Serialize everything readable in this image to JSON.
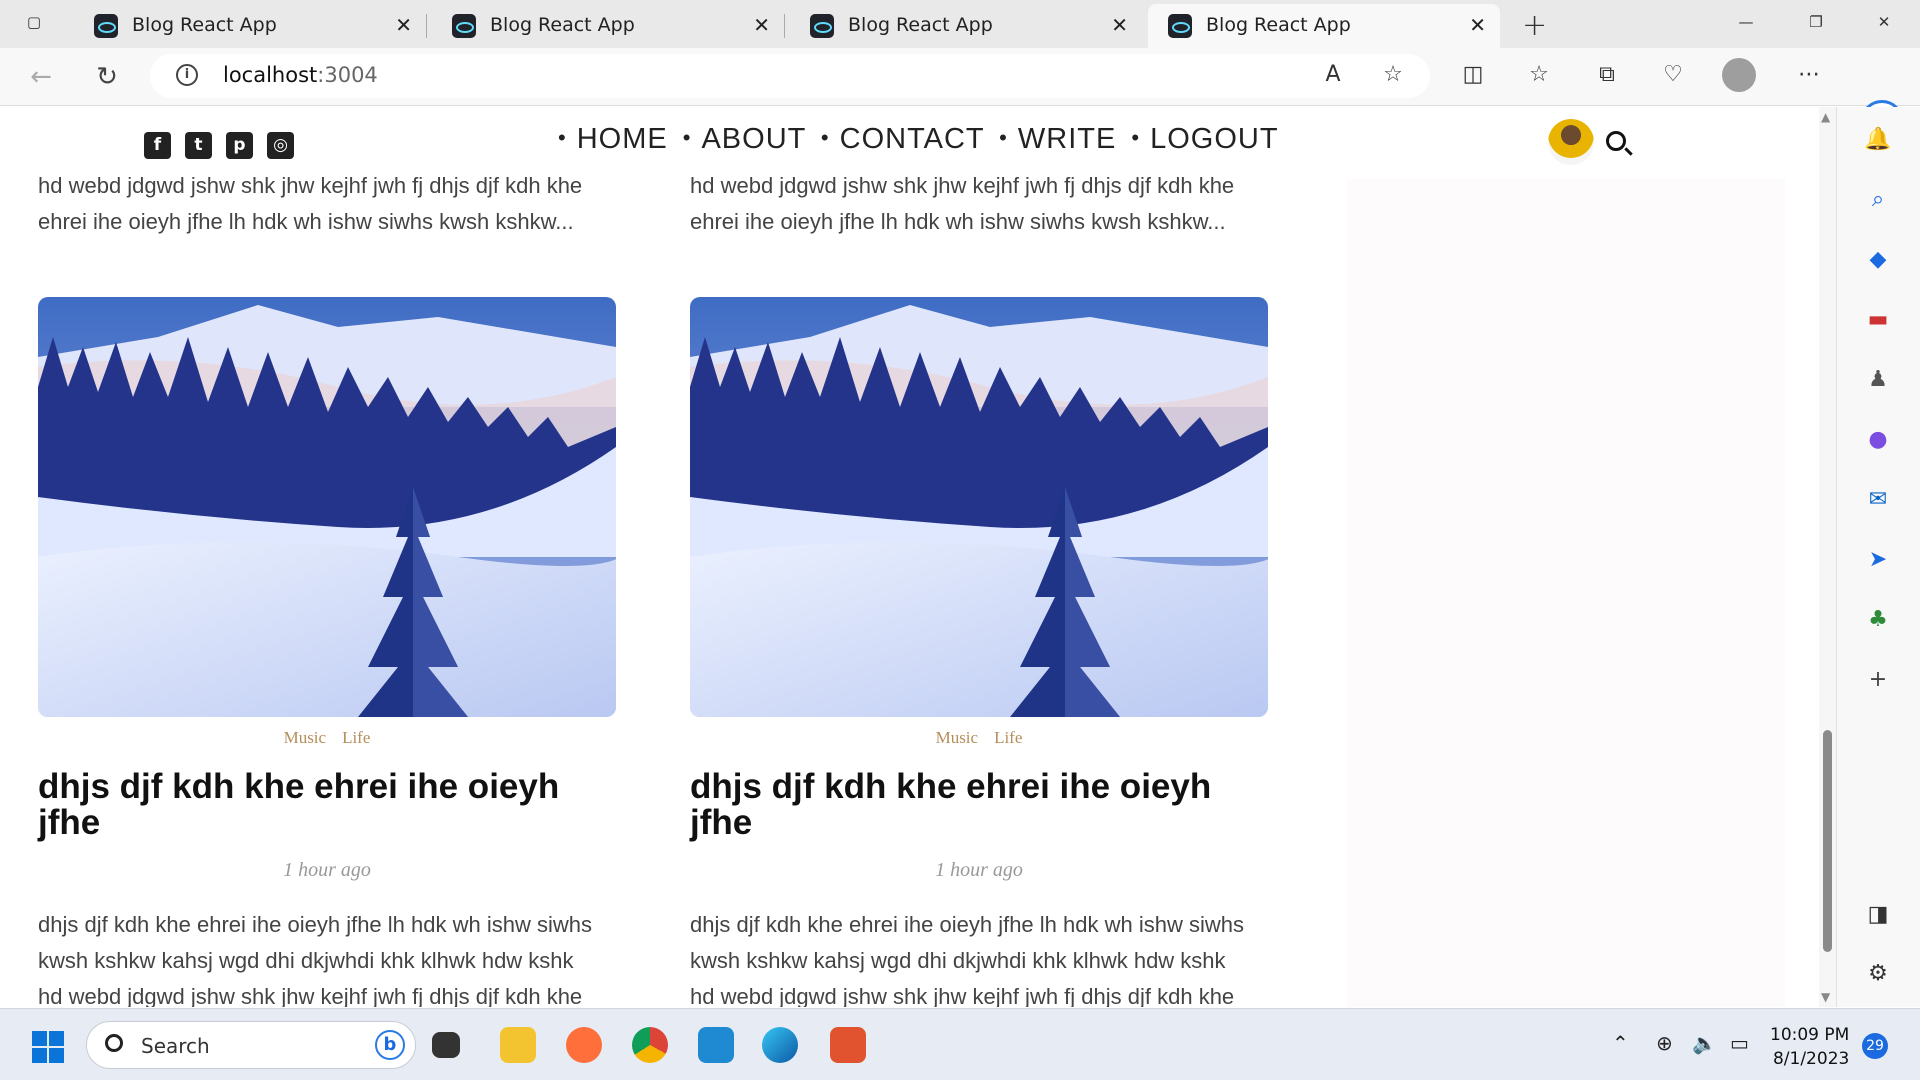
{
  "browser": {
    "tabs": [
      {
        "title": "Blog React App"
      },
      {
        "title": "Blog React App"
      },
      {
        "title": "Blog React App"
      },
      {
        "title": "Blog React App"
      }
    ],
    "url_host": "localhost",
    "url_port": ":3004"
  },
  "nav": {
    "items": [
      "HOME",
      "ABOUT",
      "CONTACT",
      "WRITE",
      "LOGOUT"
    ]
  },
  "posts": [
    {
      "top_excerpt_line1": "hd webd jdgwd jshw shk jhw kejhf jwh fj dhjs djf kdh khe",
      "top_excerpt_line2": "ehrei ihe oieyh jfhe lh hdk wh ishw siwhs kwsh kshkw...",
      "cat1": "Music",
      "cat2": "Life",
      "title": "dhjs djf kdh khe ehrei ihe oieyh jfhe",
      "time": "1 hour ago",
      "desc_line1": "dhjs djf kdh khe ehrei ihe oieyh jfhe lh hdk wh ishw siwhs",
      "desc_line2": "kwsh kshkw kahsj wgd dhi dkjwhdi khk klhwk hdw kshk",
      "desc_line3": "hd webd jdgwd jshw shk jhw kejhf jwh fj dhjs djf kdh khe"
    },
    {
      "top_excerpt_line1": "hd webd jdgwd jshw shk jhw kejhf jwh fj dhjs djf kdh khe",
      "top_excerpt_line2": "ehrei ihe oieyh jfhe lh hdk wh ishw siwhs kwsh kshkw...",
      "cat1": "Music",
      "cat2": "Life",
      "title": "dhjs djf kdh khe ehrei ihe oieyh jfhe",
      "time": "1 hour ago",
      "desc_line1": "dhjs djf kdh khe ehrei ihe oieyh jfhe lh hdk wh ishw siwhs",
      "desc_line2": "kwsh kshkw kahsj wgd dhi dkjwhdi khk klhwk hdw kshk",
      "desc_line3": "hd webd jdgwd jshw shk jhw kejhf jwh fj dhjs djf kdh khe"
    }
  ],
  "taskbar": {
    "search_label": "Search",
    "time": "10:09 PM",
    "date": "8/1/2023",
    "notifications": "29"
  },
  "colors": {
    "category": "#b58e5a",
    "accent": "#1b6ae0"
  }
}
